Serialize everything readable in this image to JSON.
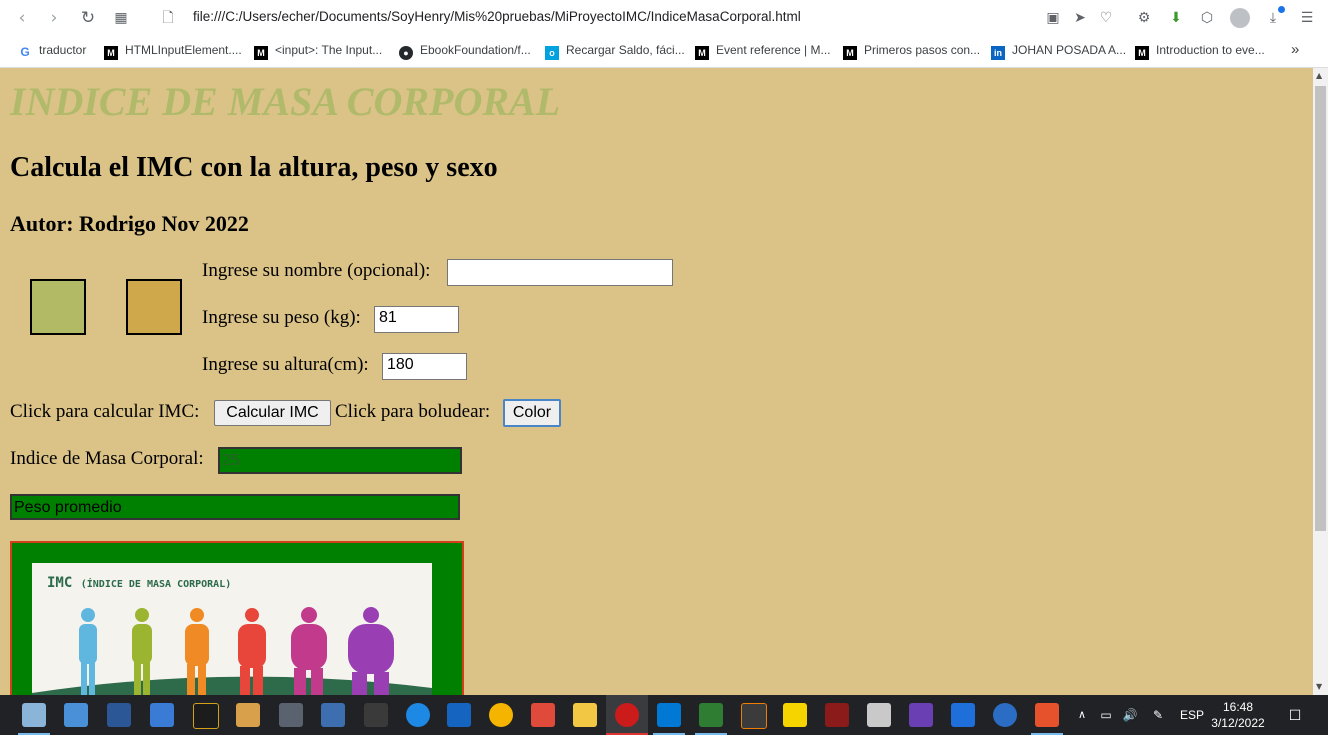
{
  "browser": {
    "url": "file:///C:/Users/echer/Documents/SoyHenry/Mis%20pruebas/MiProyectoIMC/IndiceMasaCorporal.html",
    "bookmarks": [
      {
        "label": "traductor",
        "icon": "google-icon"
      },
      {
        "label": "HTMLInputElement....",
        "icon": "mdn-icon"
      },
      {
        "label": "<input>: The Input...",
        "icon": "mdn-icon"
      },
      {
        "label": "EbookFoundation/f...",
        "icon": "github-icon"
      },
      {
        "label": "Recargar Saldo, fáci...",
        "icon": "recarga-icon"
      },
      {
        "label": "Event reference | M...",
        "icon": "mdn-icon"
      },
      {
        "label": "Primeros pasos con...",
        "icon": "mdn-icon"
      },
      {
        "label": "JOHAN POSADA A...",
        "icon": "linkedin-icon"
      },
      {
        "label": "Introduction to eve...",
        "icon": "mdn-icon"
      }
    ],
    "bookmarks_more": "»"
  },
  "page": {
    "title": "INDICE DE MASA CORPORAL",
    "subtitle": "Calcula el IMC con la altura, peso y sexo",
    "author": "Autor: Rodrigo Nov 2022",
    "colors": {
      "background": "#dbc388",
      "square_left": "#b2ba66",
      "square_right": "#d0a84c",
      "result_bg": "#008000"
    },
    "form": {
      "name_label": "Ingrese su nombre (opcional):",
      "name_value": "",
      "weight_label": "Ingrese su peso (kg):",
      "weight_value": "81",
      "height_label": "Ingrese su altura(cm):",
      "height_value": "180",
      "calc_prompt": "Click para calcular IMC:",
      "calc_button": "Calcular IMC",
      "color_prompt": "Click para boludear:",
      "color_button": "Color",
      "imc_label": "Indice de Masa Corporal:",
      "imc_value": "25",
      "status_value": "Peso promedio"
    },
    "poster": {
      "title": "IMC",
      "subtitle": "(ÍNDICE DE MASA CORPORAL)",
      "figure_colors": [
        "#5fb7e0",
        "#9cb531",
        "#f08a24",
        "#e8463a",
        "#c13a8c",
        "#9a3fb3"
      ]
    }
  },
  "taskbar": {
    "language": "ESP",
    "time": "16:48",
    "date": "3/12/2022"
  }
}
